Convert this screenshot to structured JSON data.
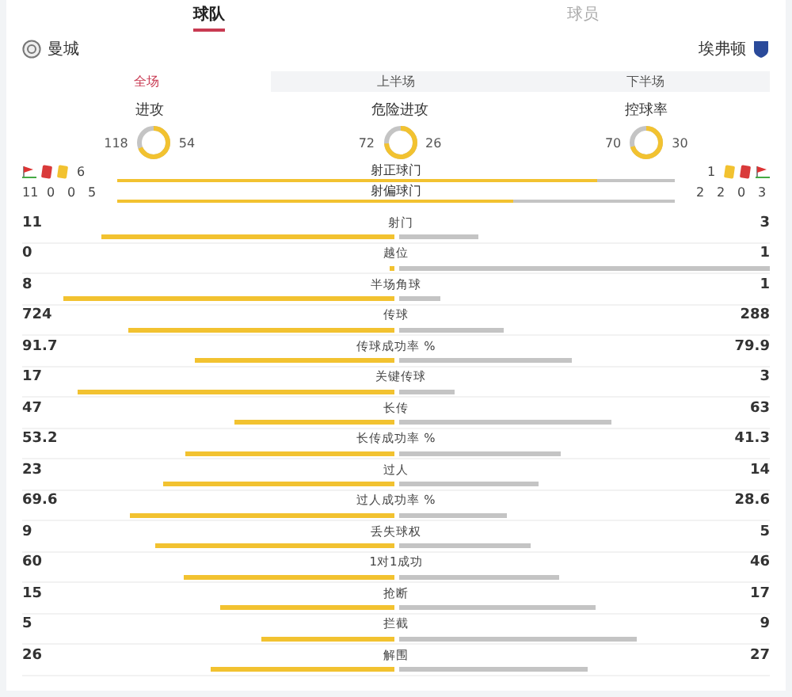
{
  "tabs": [
    {
      "label": "球队",
      "selected": true
    },
    {
      "label": "球员",
      "selected": false
    }
  ],
  "teams": {
    "home": {
      "name": "曼城"
    },
    "away": {
      "name": "埃弗顿"
    }
  },
  "periods": [
    {
      "label": "全场",
      "selected": true
    },
    {
      "label": "上半场",
      "selected": false
    },
    {
      "label": "下半场",
      "selected": false
    }
  ],
  "rings": [
    {
      "label": "进攻",
      "home": "118",
      "away": "54"
    },
    {
      "label": "危险进攻",
      "home": "72",
      "away": "26"
    },
    {
      "label": "控球率",
      "home": "70",
      "away": "30"
    }
  ],
  "events": {
    "home_counts": [
      "11",
      "0",
      "0"
    ],
    "away_counts": [
      "2",
      "0",
      "3"
    ]
  },
  "shots": [
    {
      "label": "射正球门",
      "home": "6",
      "away": "1",
      "level": 0.86
    },
    {
      "label": "射偏球门",
      "home": "5",
      "away": "2",
      "level": 0.71
    }
  ],
  "stats": [
    {
      "label": "射门",
      "home": "11",
      "away": "3"
    },
    {
      "label": "越位",
      "home": "0",
      "away": "1"
    },
    {
      "label": "半场角球",
      "home": "8",
      "away": "1"
    },
    {
      "label": "传球",
      "home": "724",
      "away": "288"
    },
    {
      "label": "传球成功率 %",
      "home": "91.7",
      "away": "79.9"
    },
    {
      "label": "关键传球",
      "home": "17",
      "away": "3"
    },
    {
      "label": "长传",
      "home": "47",
      "away": "63"
    },
    {
      "label": "长传成功率 %",
      "home": "53.2",
      "away": "41.3"
    },
    {
      "label": "过人",
      "home": "23",
      "away": "14"
    },
    {
      "label": "过人成功率 %",
      "home": "69.6",
      "away": "28.6"
    },
    {
      "label": "丢失球权",
      "home": "9",
      "away": "5"
    },
    {
      "label": "1对1成功",
      "home": "60",
      "away": "46"
    },
    {
      "label": "抢断",
      "home": "15",
      "away": "17"
    },
    {
      "label": "拦截",
      "home": "5",
      "away": "9"
    },
    {
      "label": "解围",
      "home": "26",
      "away": "27"
    }
  ]
}
